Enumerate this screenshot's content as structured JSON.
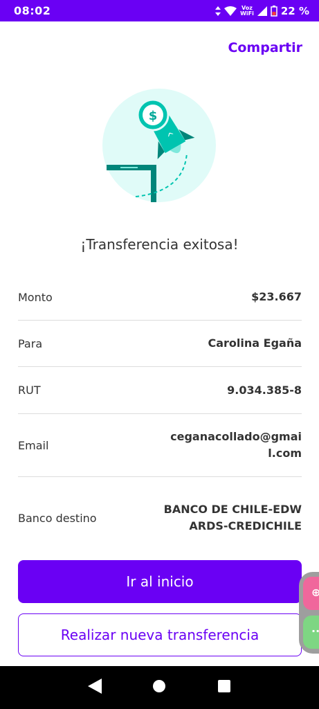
{
  "status_bar": {
    "time": "08:02",
    "network_top": "Voz",
    "network_bottom": "WiFi",
    "battery": "22 %"
  },
  "header": {
    "share_label": "Compartir"
  },
  "illustration": {
    "icon": "rocket-money-icon",
    "symbol": "$"
  },
  "success_title": "¡Transferencia exitosa!",
  "details": [
    {
      "label": "Monto",
      "value": "$23.667"
    },
    {
      "label": "Para",
      "value": "Carolina Egaña"
    },
    {
      "label": "RUT",
      "value": "9.034.385-8"
    },
    {
      "label": "Email",
      "value": "ceganacollado@gmail.com"
    },
    {
      "label": "Banco destino",
      "value": "BANCO DE CHILE-EDWARDS-CREDICHILE"
    }
  ],
  "buttons": {
    "home_label": "Ir al inicio",
    "new_transfer_label": "Realizar nueva transferencia"
  },
  "colors": {
    "primary": "#6a00f4",
    "accent_teal": "#00c4b0",
    "illustration_bg": "#e0fbf8"
  },
  "nav_icons": [
    "back-icon",
    "home-icon",
    "recents-icon"
  ]
}
